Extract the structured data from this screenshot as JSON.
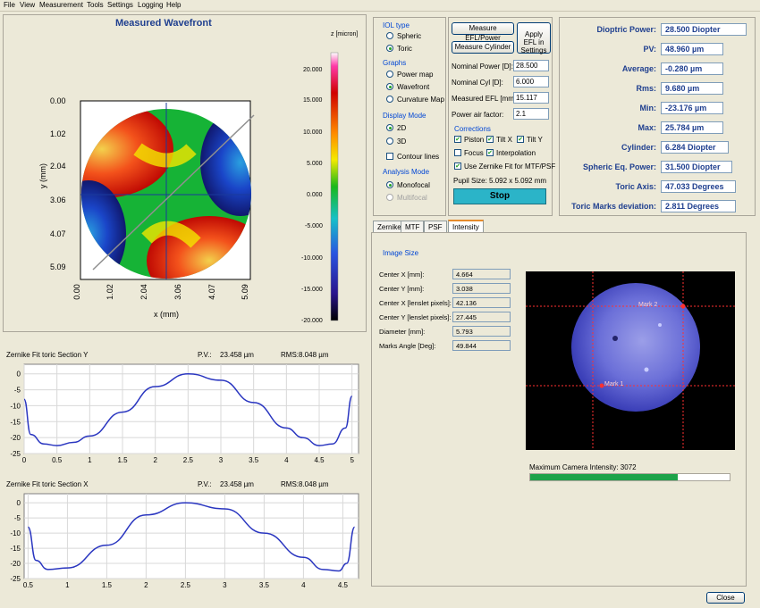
{
  "menu": [
    "File",
    "View",
    "Measurement",
    "Tools",
    "Settings",
    "Logging",
    "Help"
  ],
  "wavefront": {
    "title": "Measured Wavefront",
    "xlabel": "x (mm)",
    "ylabel": "y (mm)",
    "yticks": [
      "0.00",
      "1.02",
      "2.04",
      "3.06",
      "4.07",
      "5.09"
    ],
    "xticks": [
      "0.00",
      "1.02",
      "2.04",
      "3.06",
      "4.07",
      "5.09"
    ],
    "colorbar_title": "z [micron]",
    "colorbar_ticks": [
      "20.000",
      "15.000",
      "10.000",
      "5.000",
      "0.000",
      "-5.000",
      "-10.000",
      "-15.000",
      "-20.000"
    ]
  },
  "iol": {
    "group_type": "IOL type",
    "spheric": "Spheric",
    "toric": "Toric",
    "group_graphs": "Graphs",
    "power_map": "Power map",
    "wavefront": "Wavefront",
    "curvature_map": "Curvature Map",
    "group_display": "Display Mode",
    "mode_2d": "2D",
    "mode_3d": "3D",
    "contour_lines": "Contour lines",
    "group_analysis": "Analysis Mode",
    "monofocal": "Monofocal",
    "multifocal": "Multifocal"
  },
  "measure": {
    "btn_efl": "Measure EFL/Power",
    "btn_cyl": "Measure Cylinder",
    "btn_apply": "Apply EFL in Settings",
    "nominal_power_label": "Nominal Power [D]:",
    "nominal_power": "28.500",
    "nominal_cyl_label": "Nominal Cyl [D]:",
    "nominal_cyl": "6.000",
    "measured_efl_label": "Measured EFL [mm]:",
    "measured_efl": "15.117",
    "power_air_label": "Power air factor:",
    "power_air": "2.1",
    "corrections": "Corrections",
    "piston": "Piston",
    "tilt_x": "Tilt X",
    "tilt_y": "Tilt Y",
    "focus": "Focus",
    "interpolation": "Interpolation",
    "zernike_fit": "Use Zernike Fit for MTF/PSF",
    "pupil_size": "Pupil Size: 5.092 x 5.092 mm",
    "stop": "Stop"
  },
  "stats": [
    {
      "label": "Dioptric Power:",
      "value": "28.500 Diopter"
    },
    {
      "label": "PV:",
      "value": "48.960 µm"
    },
    {
      "label": "Average:",
      "value": "-0.280 µm"
    },
    {
      "label": "Rms:",
      "value": "9.680 µm"
    },
    {
      "label": "Min:",
      "value": "-23.176 µm"
    },
    {
      "label": "Max:",
      "value": "25.784 µm"
    },
    {
      "label": "Cylinder:",
      "value": "6.284 Diopter"
    },
    {
      "label": "Spheric Eq. Power:",
      "value": "31.500 Diopter"
    },
    {
      "label": "Toric Axis:",
      "value": "47.033 Degrees"
    },
    {
      "label": "Toric Marks deviation:",
      "value": "2.811 Degrees"
    }
  ],
  "tabs": [
    "Zernike",
    "MTF",
    "PSF",
    "Intensity"
  ],
  "intensity": {
    "image_size": "Image Size",
    "rows": [
      {
        "label": "Center X [mm]:",
        "value": "4.664"
      },
      {
        "label": "Center Y [mm]:",
        "value": "3.038"
      },
      {
        "label": "Center X [lenslet pixels]:",
        "value": "42.136"
      },
      {
        "label": "Center Y [lenslet pixels]:",
        "value": "27.445"
      },
      {
        "label": "Diameter [mm]:",
        "value": "5.793"
      },
      {
        "label": "Marks Angle [Deg]:",
        "value": "49.844"
      }
    ],
    "mark1": "Mark 1",
    "mark2": "Mark 2",
    "max_intensity": "Maximum Camera Intensity: 3072",
    "intensity_fraction": 0.74
  },
  "section_y": {
    "title": "Zernike Fit toric Section Y",
    "pv": "P.V.:",
    "pv_value": "23.458 µm",
    "rms": "RMS:",
    "rms_value": "8.048 µm",
    "yticks": [
      "0",
      "-5",
      "-10",
      "-15",
      "-20",
      "-25"
    ],
    "xticks": [
      "0",
      "0.5",
      "1",
      "1.5",
      "2",
      "2.5",
      "3",
      "3.5",
      "4",
      "4.5",
      "5"
    ]
  },
  "section_x": {
    "title": "Zernike Fit toric Section X",
    "pv": "P.V.:",
    "pv_value": "23.458 µm",
    "rms": "RMS:",
    "rms_value": "8.048 µm",
    "yticks": [
      "0",
      "-5",
      "-10",
      "-15",
      "-20",
      "-25"
    ],
    "xticks": [
      "0.5",
      "1",
      "1.5",
      "2",
      "2.5",
      "3",
      "3.5",
      "4",
      "4.5"
    ]
  },
  "chart_data": [
    {
      "type": "line",
      "title": "Zernike Fit toric Section Y",
      "x": [
        0,
        0.1,
        0.3,
        0.5,
        0.75,
        1,
        1.5,
        2,
        2.5,
        3,
        3.5,
        4,
        4.25,
        4.5,
        4.7,
        4.9,
        5
      ],
      "y": [
        -8,
        -19,
        -22,
        -22.5,
        -21.5,
        -19.5,
        -12,
        -4,
        0,
        -2,
        -9,
        -17,
        -20,
        -22.5,
        -22,
        -17,
        -7
      ],
      "ylim": [
        -25,
        3
      ],
      "xlim": [
        0,
        5.1
      ]
    },
    {
      "type": "line",
      "title": "Zernike Fit toric Section X",
      "x": [
        0.5,
        0.6,
        0.75,
        1,
        1.5,
        2,
        2.5,
        3,
        3.5,
        4,
        4.25,
        4.45,
        4.55,
        4.65
      ],
      "y": [
        -8,
        -19,
        -22,
        -21.5,
        -14,
        -4,
        0,
        -2,
        -10,
        -18,
        -22,
        -22.5,
        -20,
        -8
      ],
      "ylim": [
        -25,
        3
      ],
      "xlim": [
        0.45,
        4.7
      ]
    }
  ],
  "close": "Close"
}
